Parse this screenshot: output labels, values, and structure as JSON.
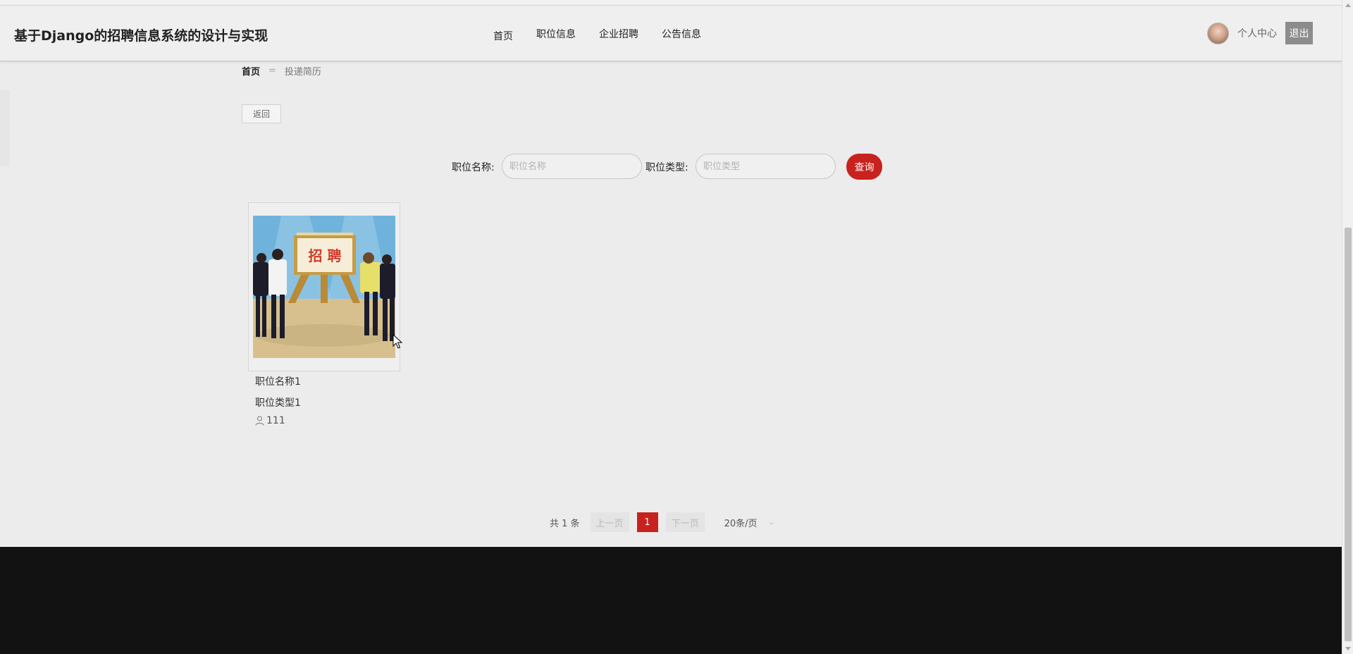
{
  "header": {
    "site_title": "基于Django的招聘信息系统的设计与实现",
    "nav": [
      "首页",
      "职位信息",
      "企业招聘",
      "公告信息"
    ],
    "user_center": "个人中心",
    "logout": "退出"
  },
  "breadcrumb": {
    "home": "首页",
    "separator": "=",
    "current": "投递简历"
  },
  "back_button": "返回",
  "search": {
    "name_label": "职位名称:",
    "name_placeholder": "职位名称",
    "type_label": "职位类型:",
    "type_placeholder": "职位类型",
    "submit": "查询"
  },
  "jobs": [
    {
      "name": "职位名称1",
      "type": "职位类型1",
      "views": "111",
      "image_text": "招 聘"
    }
  ],
  "pagination": {
    "total": "共 1 条",
    "prev": "上一页",
    "current": "1",
    "next": "下一页",
    "page_size": "20条/页"
  },
  "colors": {
    "accent": "#c8221f",
    "footer": "#121212",
    "background": "#ececec"
  },
  "icons": {
    "views": "person-icon",
    "page_size": "chevron-down-icon"
  }
}
